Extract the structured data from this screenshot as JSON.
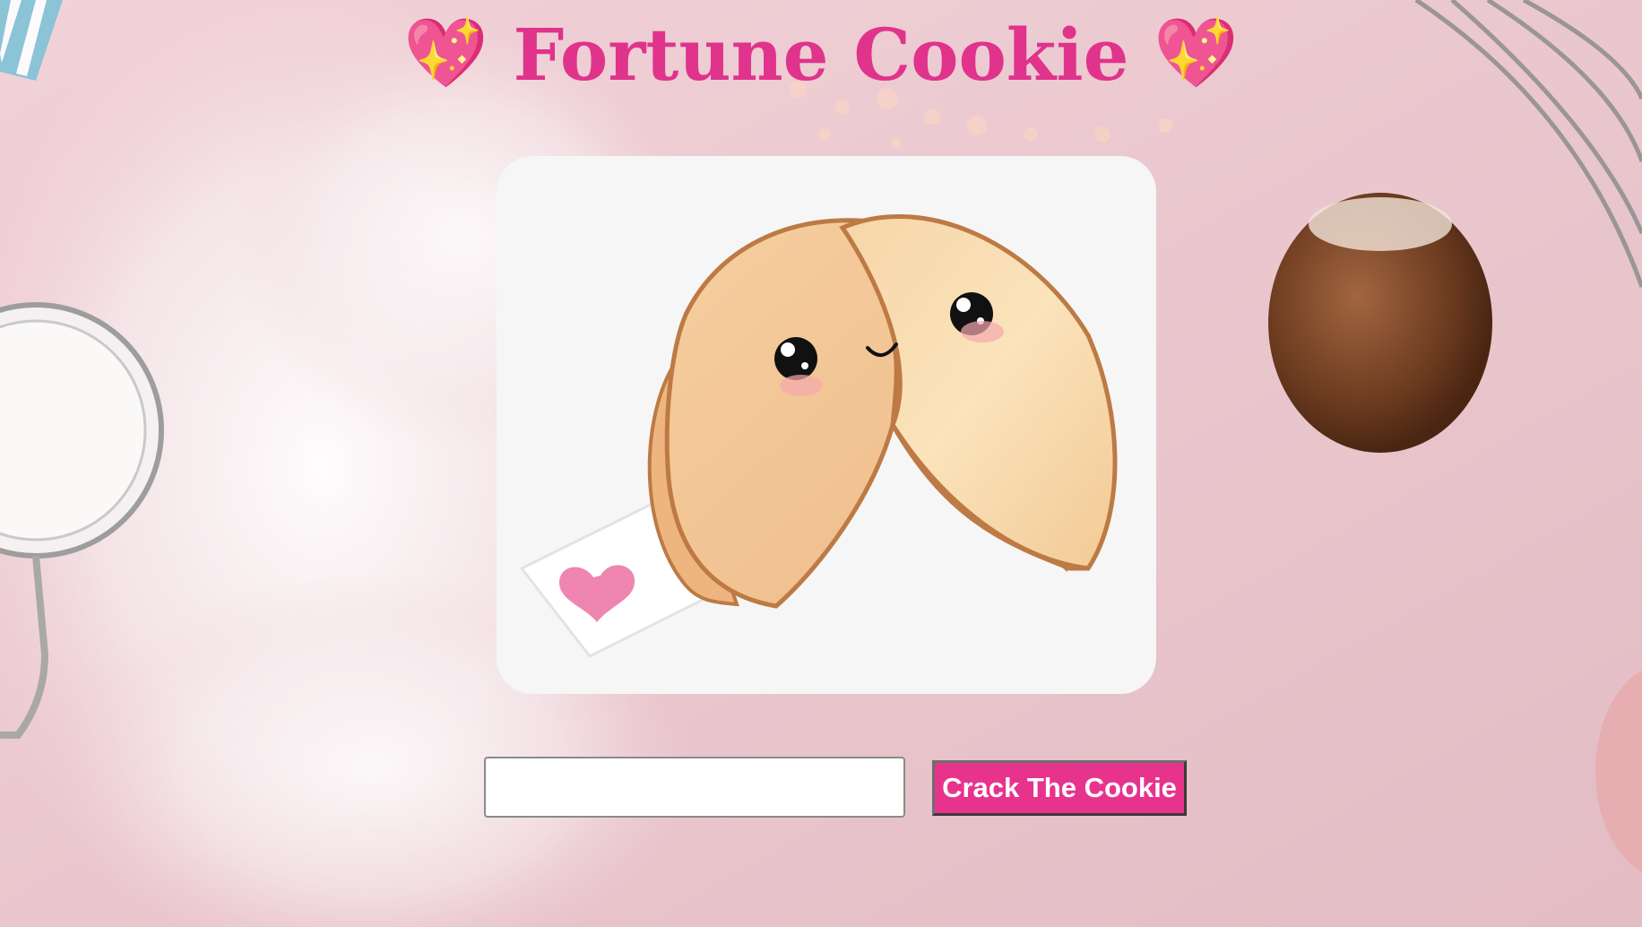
{
  "header": {
    "title": "Fortune Cookie",
    "left_emoji": "💖",
    "right_emoji": "💖"
  },
  "form": {
    "input_value": "",
    "input_placeholder": "",
    "button_label": "Crack The Cookie"
  },
  "fortune": {
    "text": "..."
  },
  "colors": {
    "title": "#e0338c",
    "button_bg": "#e8338d",
    "button_text": "#ffffff",
    "card_bg": "#f6f6f6",
    "fortune_text": "#7a63c9",
    "page_bg": "#ecc8cf"
  },
  "icons": {
    "cookie_image": "fortune-cookie-illustration",
    "heart": "sparkling-heart-icon"
  }
}
